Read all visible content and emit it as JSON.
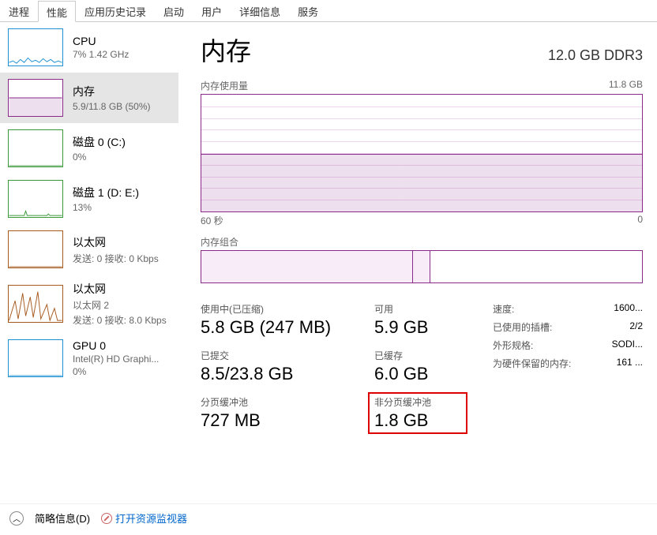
{
  "tabs": [
    "进程",
    "性能",
    "应用历史记录",
    "启动",
    "用户",
    "详细信息",
    "服务"
  ],
  "active_tab": 1,
  "sidebar": {
    "items": [
      {
        "name": "CPU",
        "sub": "7% 1.42 GHz",
        "color": "#1e90d2",
        "selected": false,
        "thumb": "cpu"
      },
      {
        "name": "内存",
        "sub": "5.9/11.8 GB (50%)",
        "color": "#8b2a8b",
        "selected": true,
        "thumb": "memory"
      },
      {
        "name": "磁盘 0 (C:)",
        "sub": "0%",
        "color": "#3a9a3a",
        "selected": false,
        "thumb": "disk"
      },
      {
        "name": "磁盘 1 (D: E:)",
        "sub": "13%",
        "color": "#3a9a3a",
        "selected": false,
        "thumb": "disk2"
      },
      {
        "name": "以太网",
        "sub": "发送: 0 接收: 0 Kbps",
        "color": "#a65a1e",
        "selected": false,
        "thumb": "eth0"
      },
      {
        "name": "以太网",
        "sub2": "以太网 2",
        "sub": "发送: 0 接收: 8.0 Kbps",
        "color": "#a65a1e",
        "selected": false,
        "thumb": "eth1"
      },
      {
        "name": "GPU 0",
        "sub2": "Intel(R) HD Graphi...",
        "sub": "0%",
        "color": "#1e90d2",
        "selected": false,
        "thumb": "gpu"
      }
    ]
  },
  "detail": {
    "title": "内存",
    "spec": "12.0 GB DDR3",
    "usage_label": "内存使用量",
    "usage_max": "11.8 GB",
    "x_left": "60 秒",
    "x_right": "0",
    "comp_label": "内存组合",
    "usage_pct": 49,
    "comp_segments": [
      48,
      4,
      48
    ],
    "stats": {
      "in_use_label": "使用中(已压缩)",
      "in_use": "5.8 GB (247 MB)",
      "avail_label": "可用",
      "avail": "5.9 GB",
      "committed_label": "已提交",
      "committed": "8.5/23.8 GB",
      "cached_label": "已缓存",
      "cached": "6.0 GB",
      "paged_label": "分页缓冲池",
      "paged": "727 MB",
      "nonpaged_label": "非分页缓冲池",
      "nonpaged": "1.8 GB"
    },
    "right": [
      {
        "k": "速度:",
        "v": "1600..."
      },
      {
        "k": "已使用的插槽:",
        "v": "2/2"
      },
      {
        "k": "外形规格:",
        "v": "SODI..."
      },
      {
        "k": "为硬件保留的内存:",
        "v": "161 ..."
      }
    ]
  },
  "footer": {
    "brief": "简略信息(D)",
    "resmon": "打开资源监视器"
  },
  "chart_data": {
    "type": "line",
    "title": "内存使用量",
    "xlabel": "60 秒 → 0",
    "ylabel": "GB",
    "ylim": [
      0,
      11.8
    ],
    "x": [
      60,
      50,
      40,
      30,
      20,
      10,
      0
    ],
    "series": [
      {
        "name": "内存",
        "values": [
          5.8,
          5.8,
          5.8,
          5.8,
          5.8,
          5.8,
          5.8
        ]
      }
    ]
  }
}
